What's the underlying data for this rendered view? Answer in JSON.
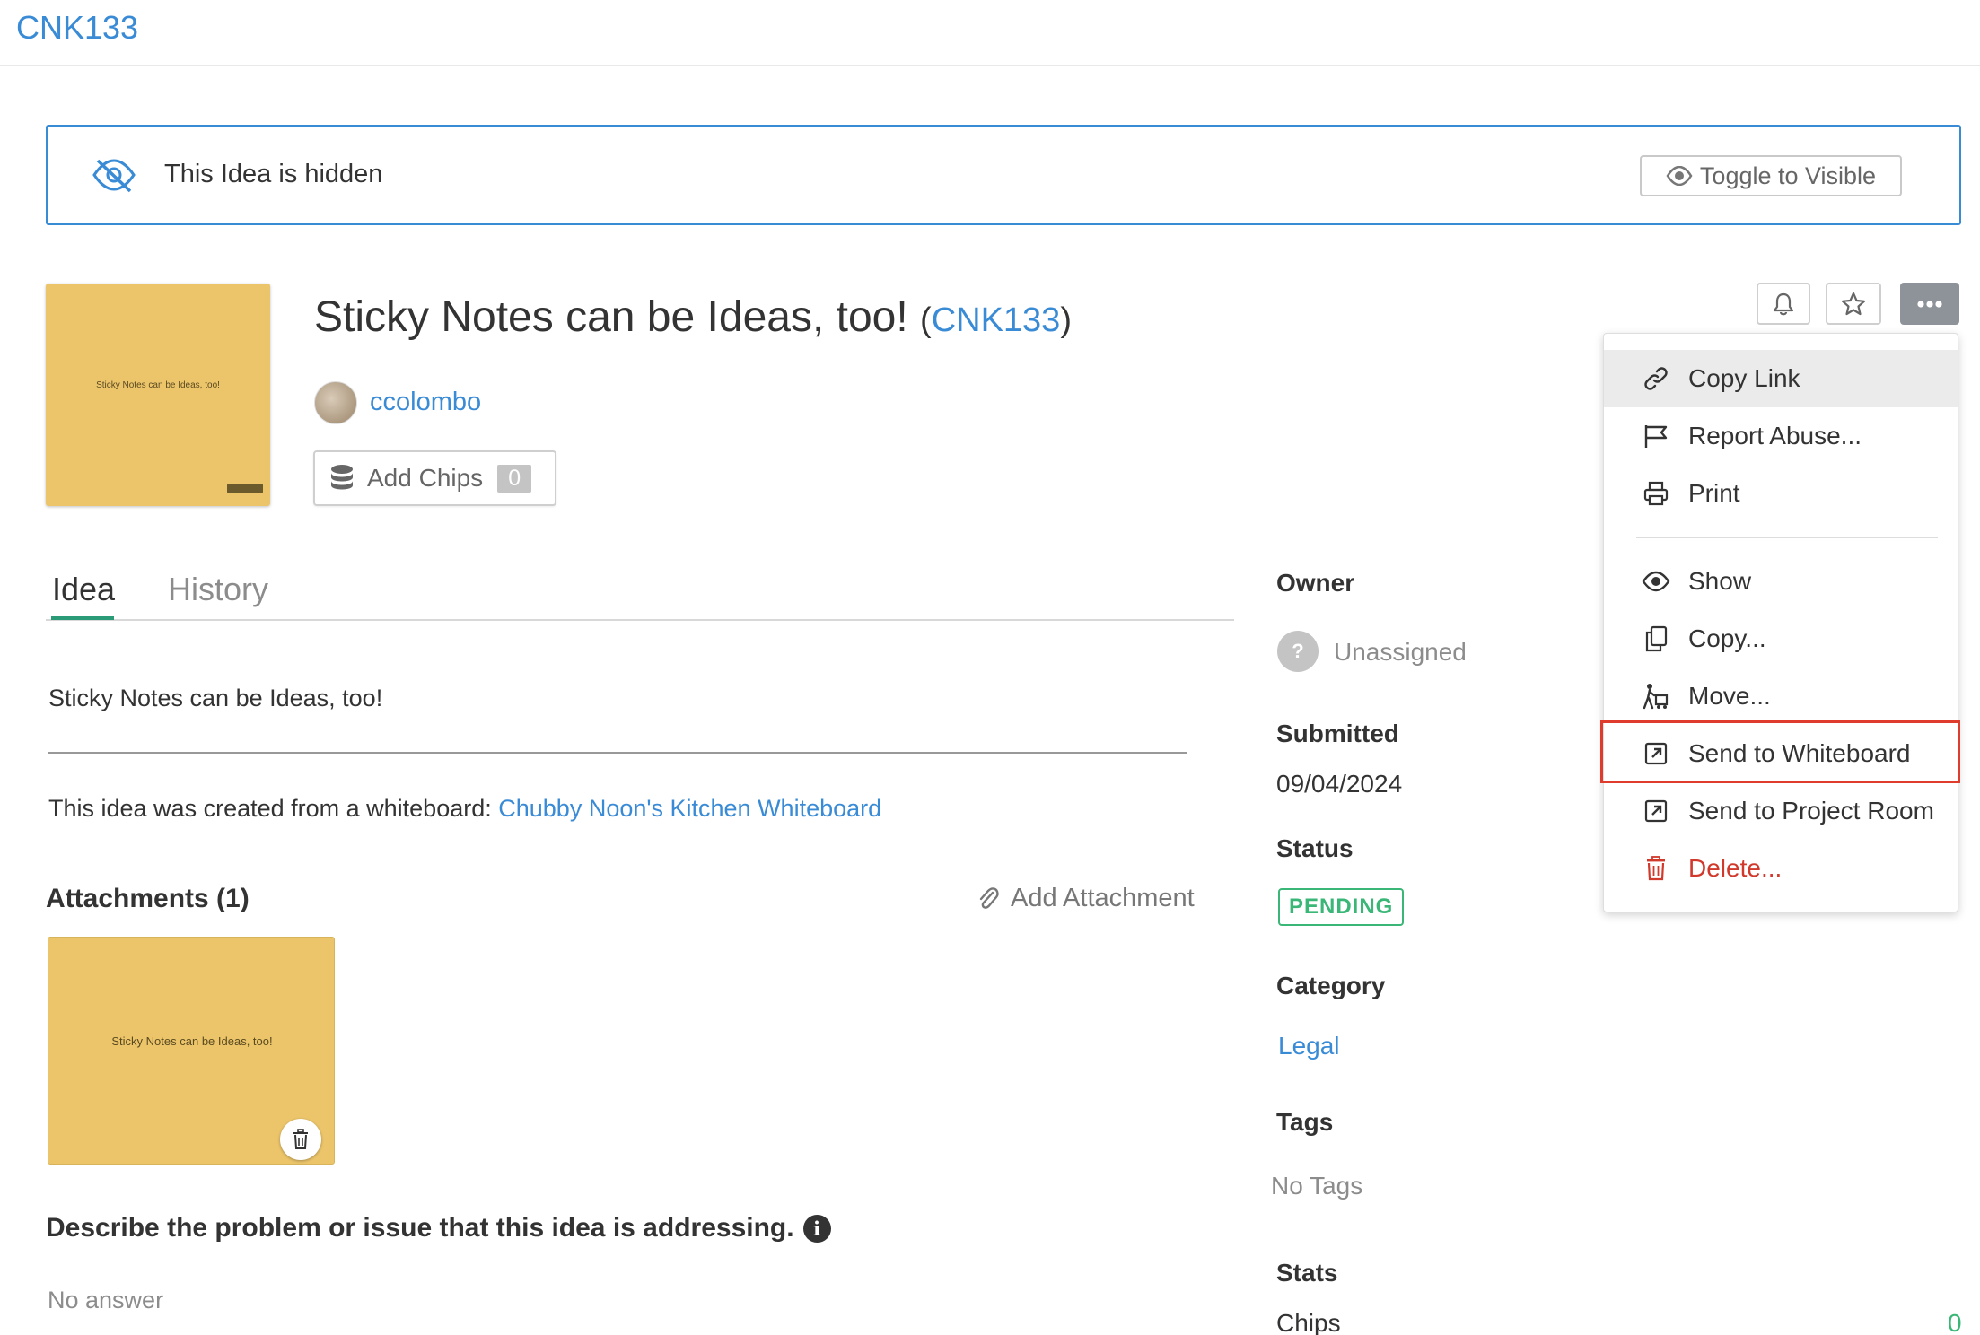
{
  "topbar": {
    "breadcrumb": "CNK133"
  },
  "banner": {
    "message": "This Idea is hidden",
    "toggle_label": "Toggle to Visible"
  },
  "idea": {
    "title": "Sticky Notes can be Ideas, too!",
    "id": "CNK133",
    "thumbnail_text": "Sticky Notes can be Ideas, too!",
    "author": "ccolombo",
    "add_chips_label": "Add Chips",
    "chips_count": "0"
  },
  "tabs": [
    {
      "label": "Idea",
      "active": true
    },
    {
      "label": "History",
      "active": false
    }
  ],
  "content": {
    "description": "Sticky Notes can be Ideas, too!",
    "created_from_prefix": "This idea was created from a whiteboard: ",
    "whiteboard_link": "Chubby Noon's Kitchen Whiteboard",
    "attachments_heading": "Attachments (1)",
    "add_attachment_label": "Add Attachment",
    "attachment_text": "Sticky Notes can be Ideas, too!",
    "question": "Describe the problem or issue that this idea is addressing.",
    "answer": "No answer"
  },
  "sidebar": {
    "owner_label": "Owner",
    "owner_value": "Unassigned",
    "submitted_label": "Submitted",
    "submitted_value": "09/04/2024",
    "status_label": "Status",
    "status_value": "PENDING",
    "category_label": "Category",
    "category_value": "Legal",
    "tags_label": "Tags",
    "tags_value": "No Tags",
    "stats_label": "Stats",
    "chips_label": "Chips",
    "chips_value": "0"
  },
  "menu": {
    "items": [
      {
        "label": "Copy Link",
        "icon": "link-icon"
      },
      {
        "label": "Report Abuse...",
        "icon": "flag-icon"
      },
      {
        "label": "Print",
        "icon": "printer-icon"
      },
      {
        "label": "Show",
        "icon": "eye-icon"
      },
      {
        "label": "Copy...",
        "icon": "copy-icon"
      },
      {
        "label": "Move...",
        "icon": "move-icon"
      },
      {
        "label": "Send to Whiteboard",
        "icon": "external-link-icon"
      },
      {
        "label": "Send to Project Room",
        "icon": "external-link-icon"
      },
      {
        "label": "Delete...",
        "icon": "trash-icon"
      }
    ]
  },
  "colors": {
    "accent": "#3a8bd6",
    "tab_active": "#2b9a77",
    "status_pending": "#3ab777",
    "danger": "#d0392b",
    "sticky_note": "#ecc56b",
    "highlight": "#e03c2e"
  }
}
